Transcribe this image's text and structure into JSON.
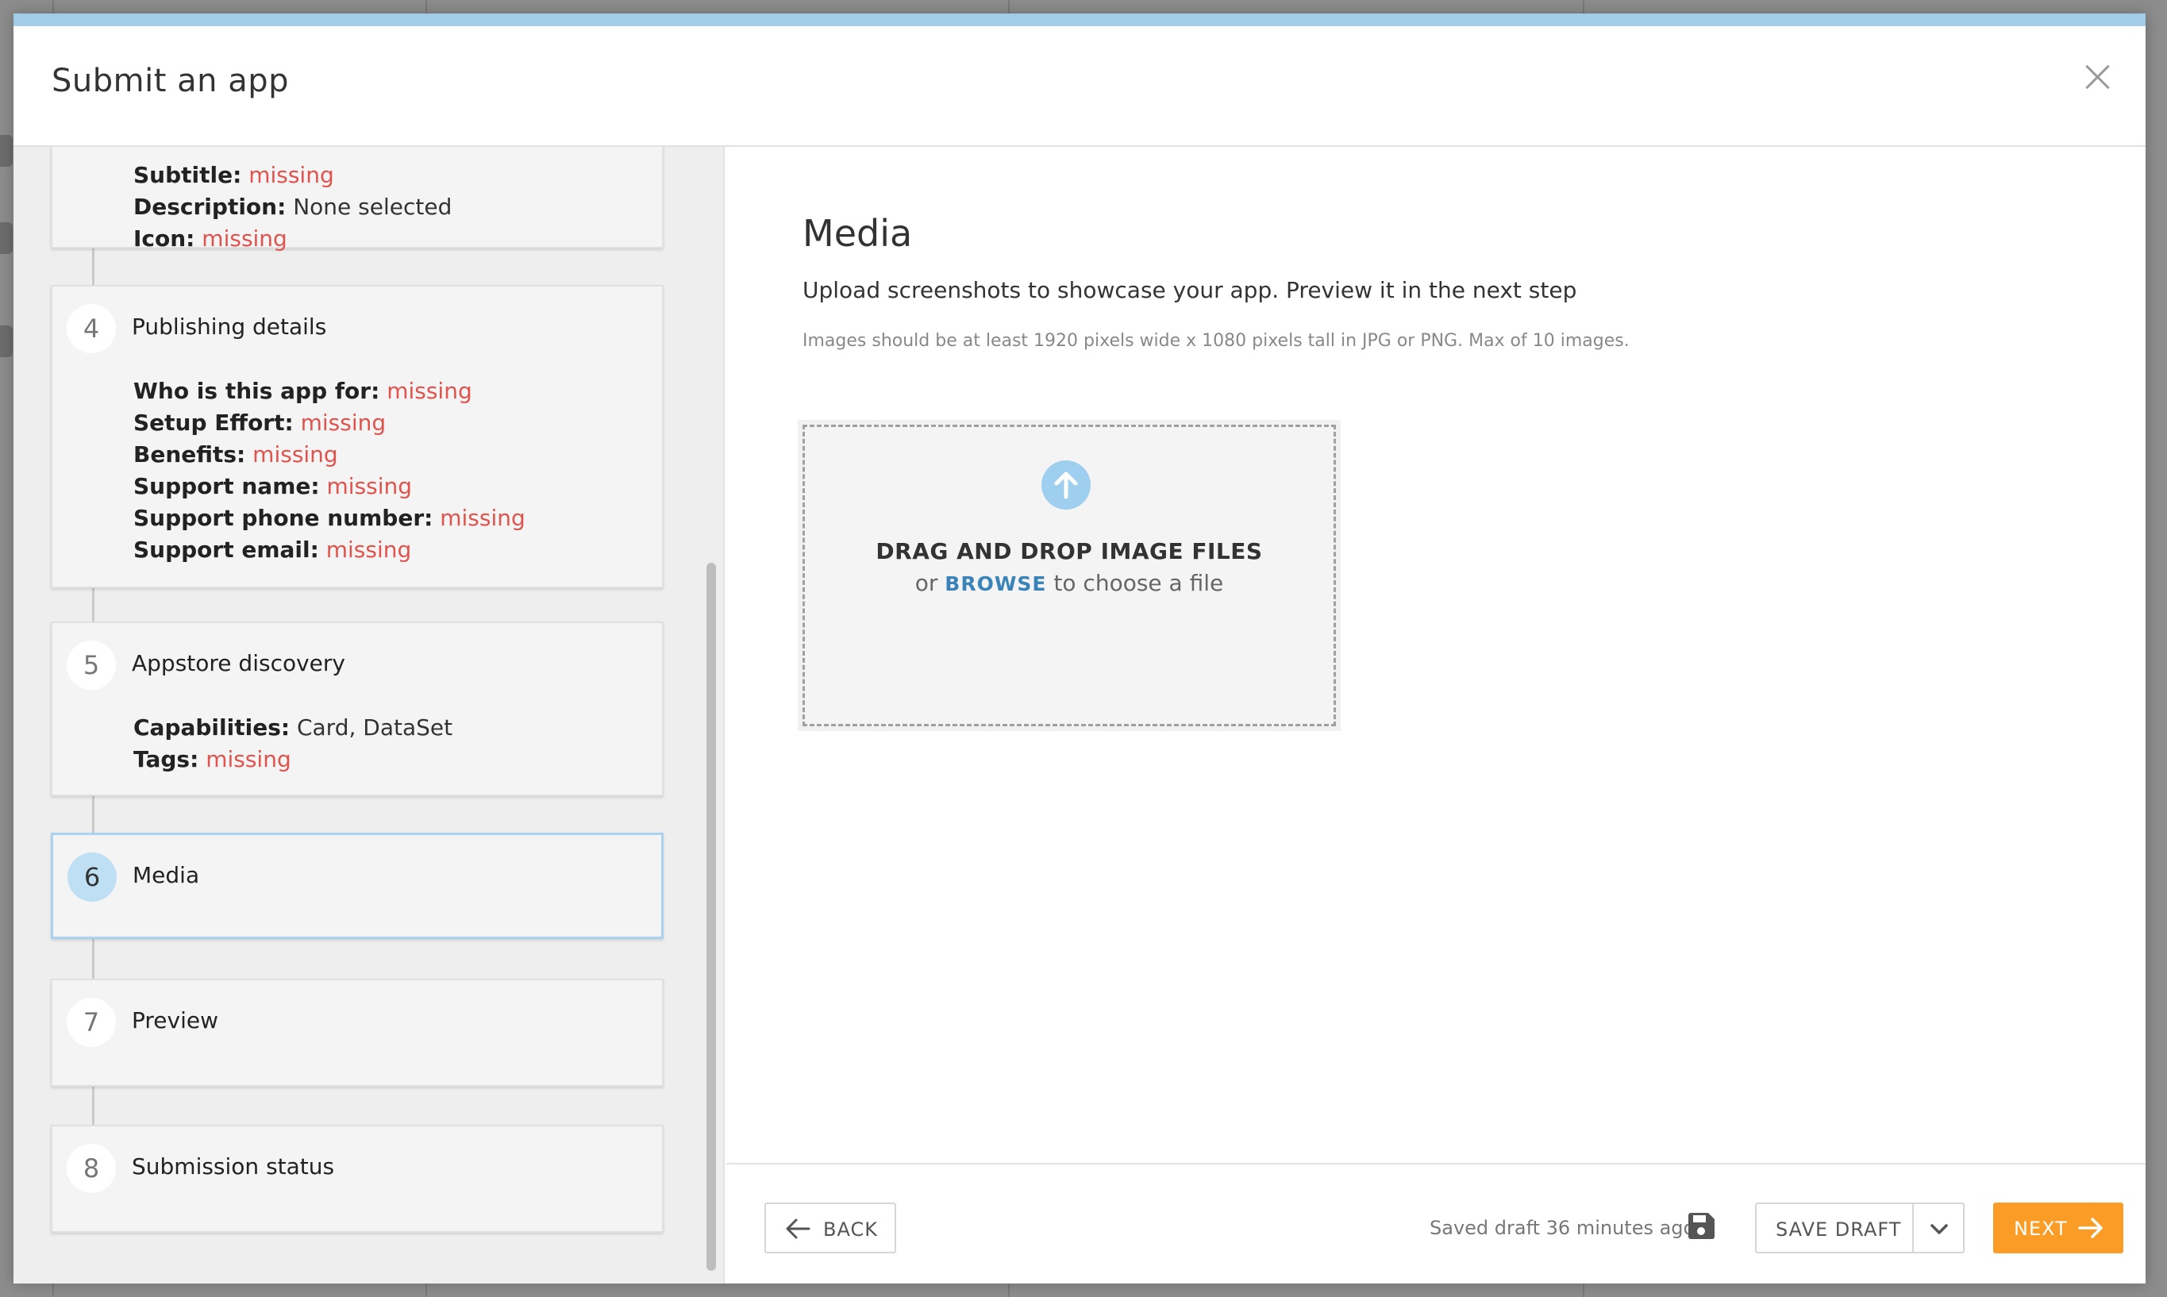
{
  "modal": {
    "title": "Submit an app"
  },
  "steps": {
    "step3": {
      "partial_row": {
        "label": "Subtitle:",
        "value": "missing"
      },
      "rows": [
        {
          "label": "Description:",
          "value": "None selected",
          "missing": false
        },
        {
          "label": "Icon:",
          "value": "missing",
          "missing": true
        }
      ]
    },
    "step4": {
      "number": "4",
      "title": "Publishing details",
      "rows": [
        {
          "label": "Who is this app for:",
          "value": "missing"
        },
        {
          "label": "Setup Effort:",
          "value": "missing"
        },
        {
          "label": "Benefits:",
          "value": "missing"
        },
        {
          "label": "Support name:",
          "value": "missing"
        },
        {
          "label": "Support phone number:",
          "value": "missing"
        },
        {
          "label": "Support email:",
          "value": "missing"
        }
      ]
    },
    "step5": {
      "number": "5",
      "title": "Appstore discovery",
      "rows": [
        {
          "label": "Capabilities:",
          "value": "Card, DataSet"
        },
        {
          "label": "Tags:",
          "value": "missing"
        }
      ]
    },
    "step6": {
      "number": "6",
      "title": "Media"
    },
    "step7": {
      "number": "7",
      "title": "Preview"
    },
    "step8": {
      "number": "8",
      "title": "Submission status"
    }
  },
  "content": {
    "title": "Media",
    "subtitle": "Upload screenshots to showcase your app. Preview it in the next step",
    "hint": "Images should be at least 1920 pixels wide x 1080 pixels tall in JPG or PNG. Max of 10 images.",
    "dropzone": {
      "title": "DRAG AND DROP IMAGE FILES",
      "prefix": "or ",
      "browse": "BROWSE",
      "suffix": " to choose a file",
      "icon": "upload-arrow-icon"
    }
  },
  "footer": {
    "back_label": "BACK",
    "saved_text": "Saved draft 36 minutes ago",
    "save_draft_label": "SAVE DRAFT",
    "next_label": "NEXT"
  },
  "colors": {
    "accent_top": "#a1cde9",
    "missing": "#e1534d",
    "next_button": "#fa9c25",
    "browse_link": "#3a83b9",
    "active_step_border": "#a9d3ef"
  }
}
